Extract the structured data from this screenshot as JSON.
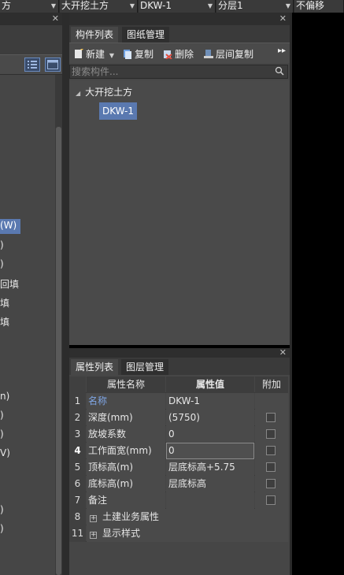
{
  "top_dropdowns": [
    {
      "value": "方"
    },
    {
      "value": "大开挖土方"
    },
    {
      "value": "DKW-1"
    },
    {
      "value": "分层1"
    },
    {
      "value": "不偏移"
    }
  ],
  "left_panel": {
    "partial_items": [
      "(W)",
      ")",
      ")",
      "回填",
      "填",
      "填",
      "n)",
      ")",
      ")",
      "V)",
      ")",
      ")"
    ]
  },
  "component_panel": {
    "tabs": [
      {
        "label": "构件列表",
        "active": true
      },
      {
        "label": "图纸管理",
        "active": false
      }
    ],
    "toolbar": {
      "new_label": "新建",
      "copy_label": "复制",
      "delete_label": "删除",
      "floor_copy_label": "层间复制",
      "more_label": "▸▸"
    },
    "search": {
      "placeholder": "搜索构件..."
    },
    "tree": {
      "parent": "大开挖土方",
      "child": "DKW-1"
    }
  },
  "property_panel": {
    "tabs": [
      {
        "label": "属性列表",
        "active": true
      },
      {
        "label": "图层管理",
        "active": false
      }
    ],
    "headers": {
      "name": "属性名称",
      "value": "属性值",
      "add": "附加"
    },
    "rows": [
      {
        "num": "1",
        "name": "名称",
        "value": "DKW-1",
        "checkbox": false
      },
      {
        "num": "2",
        "name": "深度(mm)",
        "value": "(5750)",
        "checkbox": true
      },
      {
        "num": "3",
        "name": "放坡系数",
        "value": "0",
        "checkbox": true
      },
      {
        "num": "4",
        "name": "工作面宽(mm)",
        "value": "0",
        "checkbox": true
      },
      {
        "num": "5",
        "name": "顶标高(m)",
        "value": "层底标高+5.75",
        "checkbox": true
      },
      {
        "num": "6",
        "name": "底标高(m)",
        "value": "层底标高",
        "checkbox": true
      },
      {
        "num": "7",
        "name": "备注",
        "value": "",
        "checkbox": true
      }
    ],
    "groups": [
      {
        "num": "8",
        "label": "土建业务属性",
        "expander": "+"
      },
      {
        "num": "11",
        "label": "显示样式",
        "expander": "+"
      }
    ]
  },
  "colors": {
    "selected_blue": "#5a79b0",
    "link_blue": "#7fa6e6",
    "panel_bg": "#464646"
  }
}
